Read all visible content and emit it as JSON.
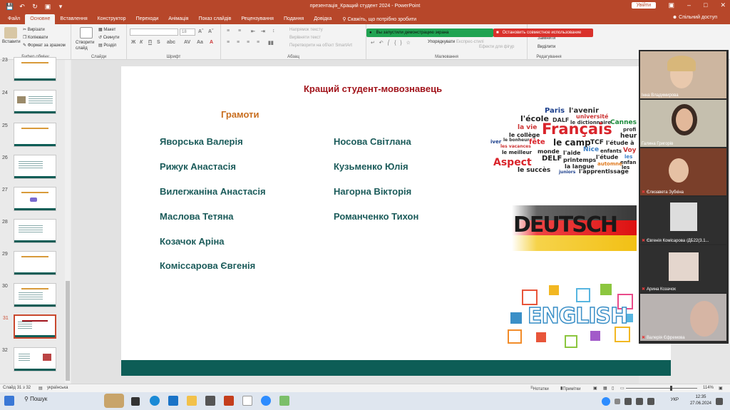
{
  "window": {
    "doc_title": "презентація_Кращий студент 2024  -  PowerPoint",
    "signin": "Увійти"
  },
  "tabs": [
    "Файл",
    "Основне",
    "Вставлення",
    "Конструктор",
    "Переходи",
    "Анімація",
    "Показ слайдів",
    "Рецензування",
    "Подання",
    "Довідка"
  ],
  "tellme": "Скажіть, що потрібно зробити",
  "share": "Спільний доступ",
  "ribbon": {
    "clipboard": {
      "paste": "Вставити",
      "cut": "Вирізати",
      "copy": "Копіювати",
      "format": "Формат за зразком",
      "label": "Буфер обміну"
    },
    "slides": {
      "new": "Створити слайд",
      "layout": "Макет",
      "reset": "Скинути",
      "section": "Розділ",
      "label": "Слайди"
    },
    "font": {
      "size": "18",
      "label": "Шрифт"
    },
    "paragraph": {
      "direction": "Напрямок тексту",
      "align": "Вирівняти текст",
      "smartart": "Перетворити на об'єкт SmartArt",
      "label": "Абзац"
    },
    "drawing": {
      "arrange": "Упорядкувати",
      "quick": "Експрес-стилі",
      "effects": "Ефекти для фігур",
      "label": "Малювання"
    },
    "editing": {
      "replace": "Замінити",
      "select": "Виділити",
      "label": "Редагування"
    }
  },
  "share_bar": {
    "sharing": "Вы запустили демонстрацию экрана",
    "stop": "Остановить совместное использование"
  },
  "thumbnails": [
    "23",
    "24",
    "25",
    "26",
    "27",
    "28",
    "29",
    "30",
    "31",
    "32"
  ],
  "slide": {
    "title": "Кращий студент-мовознавець",
    "subtitle": "Грамоти",
    "left_names": [
      "Яворська Валерія",
      "Рижук Анастасія",
      "Вилегжаніна Анастасія",
      "Маслова Тетяна",
      "Козачок Аріна",
      "Коміссарова Євгенія"
    ],
    "right_names": [
      "Носова Світлана",
      "Кузьменко Юлія",
      "Нагорна Вікторія",
      "Романченко Тихон"
    ],
    "deutsch_word": "DEUTSCH",
    "english_word": "ENGLISH",
    "cloud_words": [
      "Paris",
      "l'avenir",
      "université",
      "l'école",
      "DALF",
      "le dictionnaire",
      "Cannes",
      "la vie",
      "Français",
      "profi",
      "le collège",
      "heur",
      "iver",
      "le bonheur",
      "fête",
      "le camp",
      "TCF",
      "l'étude à",
      "les vacances",
      "Nice",
      "Voy",
      "le meilleur",
      "monde",
      "l'aide",
      "enfants",
      "les",
      "DELF",
      "printemps",
      "l'étude",
      "enfan",
      "Aspect",
      "la langue",
      "automne",
      "les",
      "le succès",
      "juniors",
      "l'apprentissage"
    ]
  },
  "participants": [
    "Інна Владимирова",
    "Галина Григорів",
    "Єлизавета Зубкіна",
    "Євгенія Комісарова /ДБ22(3.1...",
    "Арина Козачок",
    "Валерія Єфремова"
  ],
  "status": {
    "slide": "Слайд 31 з 32",
    "lang": "українська",
    "notes": "Нотатки",
    "comments": "Примітки",
    "zoom": "114%"
  },
  "taskbar": {
    "search": "Пошук",
    "lang": "УКР",
    "time": "12:35",
    "date": "27.06.2024"
  },
  "colors": {
    "accent": "#b7472a",
    "slide_teal": "#0d5d56",
    "title_red": "#a1141b",
    "subtitle_orange": "#c86e1f",
    "name_teal": "#1b5b5a"
  }
}
